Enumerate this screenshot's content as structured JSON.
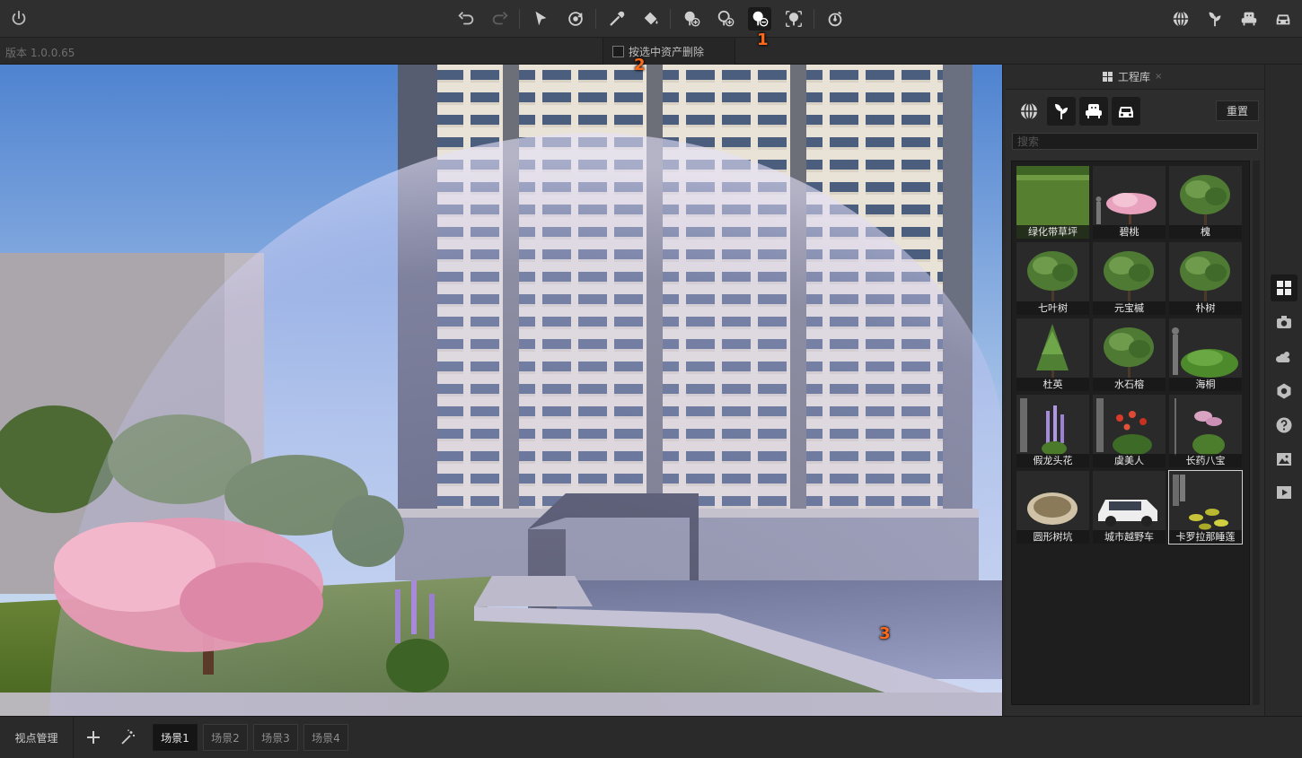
{
  "app": {
    "version": "版本 1.0.0.65"
  },
  "toolbar": {
    "buttons": [
      {
        "name": "power-icon"
      },
      {
        "name": "undo-icon"
      },
      {
        "name": "redo-icon"
      },
      {
        "name": "select-cursor-icon"
      },
      {
        "name": "rotate-target-icon"
      },
      {
        "name": "eyedropper-icon"
      },
      {
        "name": "paint-bucket-icon"
      },
      {
        "name": "tree-add-icon"
      },
      {
        "name": "tree-add-alt-icon"
      },
      {
        "name": "tree-remove-icon",
        "active": true
      },
      {
        "name": "tree-scatter-icon"
      },
      {
        "name": "weather-icon"
      }
    ],
    "right_buttons": [
      {
        "name": "globe-category-icon"
      },
      {
        "name": "plant-category-icon"
      },
      {
        "name": "furniture-category-icon"
      },
      {
        "name": "car-category-icon"
      }
    ]
  },
  "subbar": {
    "delete_selected_label": "按选中资产删除",
    "delete_selected_checked": false
  },
  "markers": {
    "m1": "1",
    "m2": "2",
    "m3": "3"
  },
  "panel": {
    "tab_title": "工程库",
    "tab_close": "×",
    "categories": [
      {
        "name": "globe-category-icon",
        "selected": false
      },
      {
        "name": "plant-category-icon",
        "selected": true
      },
      {
        "name": "furniture-category-icon",
        "selected": true
      },
      {
        "name": "car-category-icon",
        "selected": true
      }
    ],
    "reset_label": "重置",
    "search_placeholder": "搜索",
    "assets": [
      {
        "label": "绿化带草坪",
        "kind": "grass"
      },
      {
        "label": "碧桃",
        "kind": "pinktree"
      },
      {
        "label": "槐",
        "kind": "tree"
      },
      {
        "label": "七叶树",
        "kind": "tree"
      },
      {
        "label": "元宝槭",
        "kind": "tree"
      },
      {
        "label": "朴树",
        "kind": "tree"
      },
      {
        "label": "杜英",
        "kind": "conifer"
      },
      {
        "label": "水石榕",
        "kind": "tree"
      },
      {
        "label": "海桐",
        "kind": "shrub"
      },
      {
        "label": "假龙头花",
        "kind": "purpleflower"
      },
      {
        "label": "虞美人",
        "kind": "redflower"
      },
      {
        "label": "长药八宝",
        "kind": "pinkflower"
      },
      {
        "label": "圆形树坑",
        "kind": "pit"
      },
      {
        "label": "城市越野车",
        "kind": "car"
      },
      {
        "label": "卡罗拉那睡莲",
        "kind": "lily",
        "selected": true
      }
    ]
  },
  "strip": [
    {
      "name": "library-grid-icon",
      "selected": true
    },
    {
      "name": "camera-icon"
    },
    {
      "name": "weather-cloud-icon"
    },
    {
      "name": "settings-hex-icon"
    },
    {
      "name": "help-icon"
    },
    {
      "name": "image-icon"
    },
    {
      "name": "video-play-icon"
    }
  ],
  "bottombar": {
    "viewpoint_label": "视点管理",
    "scenes": [
      {
        "label": "场景1",
        "active": true
      },
      {
        "label": "场景2"
      },
      {
        "label": "场景3"
      },
      {
        "label": "场景4"
      }
    ]
  },
  "colors": {
    "marker": "#ff6a1a",
    "sky": "#5b8fd6",
    "grass": "#6f8a3a"
  }
}
